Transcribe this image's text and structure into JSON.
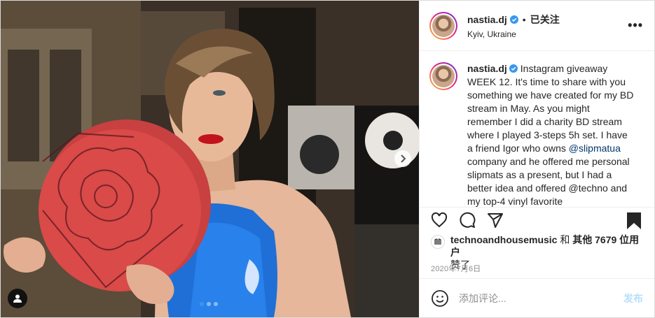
{
  "post": {
    "author": {
      "username": "nastia.dj",
      "verified_icon": "verified-badge-icon",
      "separator": "•",
      "follow_status": "已关注",
      "location": "Kyiv, Ukraine"
    },
    "caption": {
      "username": "nastia.dj",
      "text_before": "Instagram giveaway WEEK 12. It's time to share with you something we have created for my BD stream in May. As you might remember I did a charity BD stream where I played 3-steps 5h set. I have a friend Igor who owns ",
      "mention": "@slipmatua",
      "text_after": " company and he offered me personal slipmats as a present, but I had a better idea and offered @techno and my top-4 vinyl favorite"
    },
    "likes": {
      "liker": "technoandhousemusic",
      "rest": " 和 ",
      "others": "其他 7679 位用户",
      "suffix": "赞了"
    },
    "date": "2020年7月6日",
    "comment": {
      "placeholder": "添加评论...",
      "post_label": "发布"
    },
    "carousel": {
      "slides": 3,
      "active": 1
    },
    "colors": {
      "accent_blue": "#0095f6",
      "post_button_disabled": "#b2dffc",
      "muted_text": "#8e8e8e",
      "border": "#dbdbdb"
    }
  }
}
